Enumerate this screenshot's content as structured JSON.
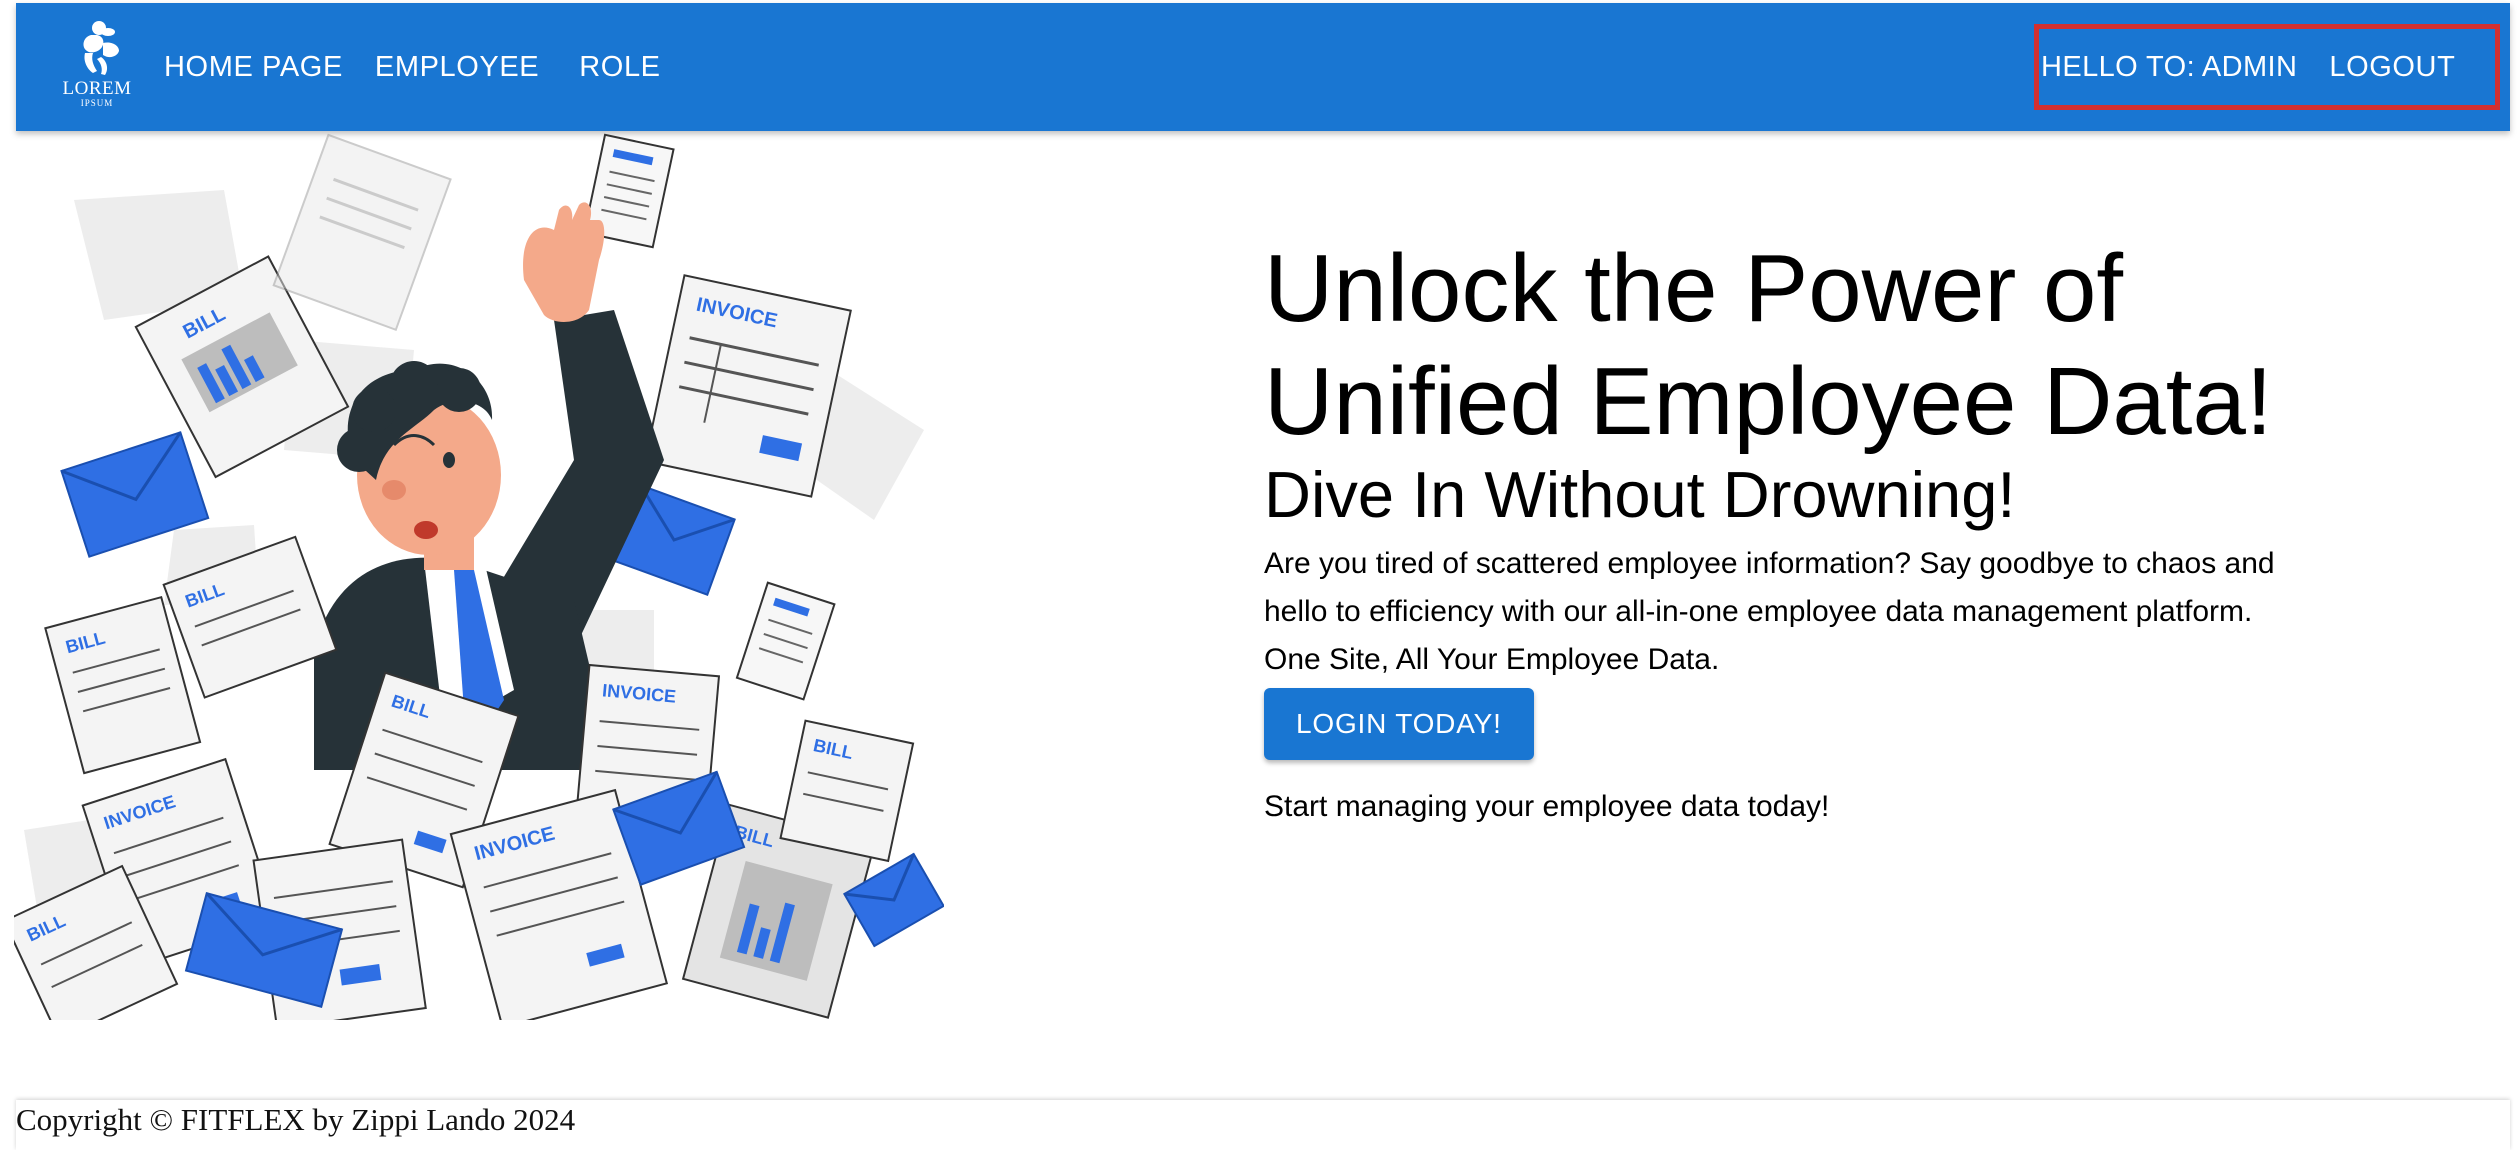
{
  "navbar": {
    "logo_text": "LOREM",
    "logo_subtext": "IPSUM",
    "links": [
      "HOME PAGE",
      "EMPLOYEE",
      "ROLE"
    ],
    "greeting": "HELLO TO: ADMIN",
    "logout_label": "LOGOUT",
    "accent_color": "#1976d2",
    "highlight_color": "#d32f2f"
  },
  "hero": {
    "illustration_icon": "person-drowning-in-papers-illustration",
    "title_line1": "Unlock the Power of",
    "title_line2": "Unified Employee Data!",
    "subtitle": "Dive In Without Drowning!",
    "description_line1": "Are you tired of scattered employee information? Say goodbye to chaos and",
    "description_line2": "hello to efficiency with our all-in-one employee data management platform.",
    "description_line3": "One Site, All Your Employee Data.",
    "cta_label": "LOGIN TODAY!",
    "footnote": "Start managing your employee data today!"
  },
  "footer": {
    "copyright": "Copyright © FITFLEX by Zippi Lando 2024"
  }
}
